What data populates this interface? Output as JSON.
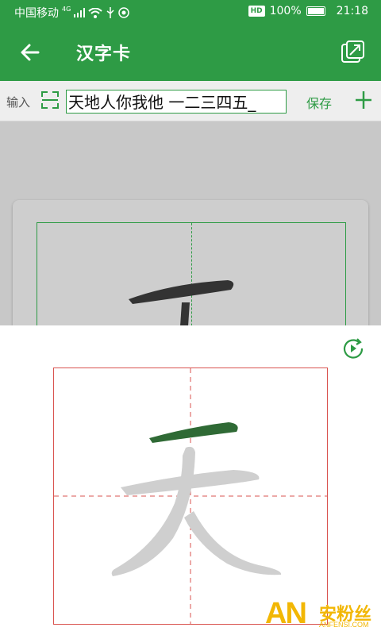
{
  "status_bar": {
    "carrier": "中国移动",
    "network": "4G",
    "hd": "HD",
    "battery": "100%",
    "time": "21:18"
  },
  "app_bar": {
    "title": "汉字卡"
  },
  "input_row": {
    "label": "输入",
    "text_value": "天地人你我他 一二三四五_",
    "save_label": "保存"
  },
  "card_preview": {
    "character": "天"
  },
  "stroke_panel": {
    "character": "天",
    "current_stroke": 1
  },
  "watermark": {
    "brand_letters": "AN",
    "brand_cn": "安粉丝",
    "brand_url": "ANFENSI.COM"
  },
  "colors": {
    "primary": "#2e9b45",
    "grid_line": "#d9534f",
    "active_stroke": "#2f6a35",
    "pending_stroke": "#cfcfcf"
  }
}
